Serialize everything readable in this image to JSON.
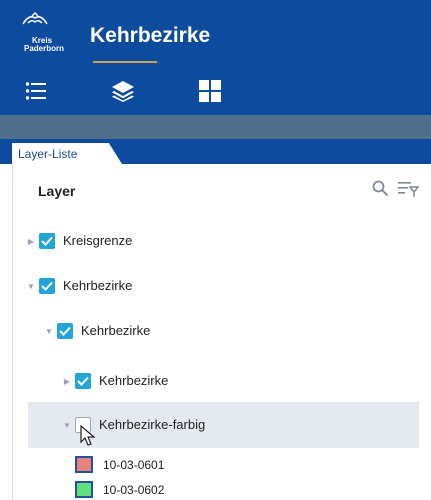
{
  "header": {
    "logo_line1": "Kreis",
    "logo_line2": "Paderborn",
    "title": "Kehrbezirke"
  },
  "toolbar": {
    "items": [
      "list-icon",
      "layers-icon",
      "grid-icon"
    ],
    "active": "layers-icon"
  },
  "tabs": [
    {
      "label": "Layer-Liste",
      "active": true
    }
  ],
  "panel": {
    "title": "Layer"
  },
  "layers": [
    {
      "label": "Kreisgrenze",
      "expanded": false,
      "checked": true
    },
    {
      "label": "Kehrbezirke",
      "expanded": true,
      "checked": true
    },
    {
      "label": "Kehrbezirke",
      "expanded": true,
      "checked": true
    },
    {
      "label": "Kehrbezirke",
      "expanded": false,
      "checked": true
    },
    {
      "label": "Kehrbezirke-farbig",
      "expanded": true,
      "checked": false,
      "selected": true
    }
  ],
  "legend": [
    {
      "label": "10-03-0601",
      "fill": "#e8827a",
      "border": "#2150a4"
    },
    {
      "label": "10-03-0602",
      "fill": "#5fe07a",
      "border": "#2150a4"
    }
  ],
  "colors": {
    "header_bg": "#0d4b9e",
    "band_bg": "#4e6e89",
    "checkbox": "#22a6d8",
    "selected_row": "#e5eaf0"
  }
}
